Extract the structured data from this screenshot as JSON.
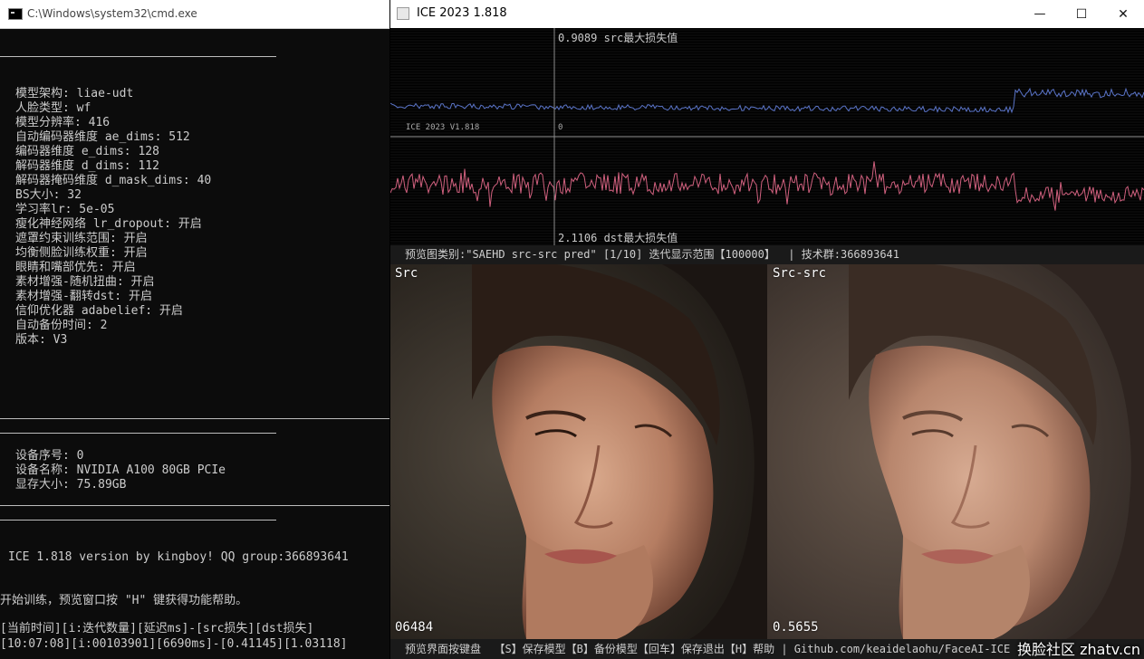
{
  "cmd": {
    "title": "C:\\Windows\\system32\\cmd.exe",
    "params": [
      "模型架构: liae-udt",
      "人脸类型: wf",
      "模型分辨率: 416",
      "自动编码器维度 ae_dims: 512",
      "编码器维度 e_dims: 128",
      "解码器维度 d_dims: 112",
      "解码器掩码维度 d_mask_dims: 40",
      "BS大小: 32",
      "学习率lr: 5e-05",
      "瘦化神经网络 lr_dropout: 开启",
      "遮罩约束训练范围: 开启",
      "均衡侧脸训练权重: 开启",
      "眼睛和嘴部优先: 开启",
      "素材增强-随机扭曲: 开启",
      "素材增强-翻转dst: 开启",
      "信仰优化器 adabelief: 开启",
      "自动备份时间: 2",
      "版本: V3"
    ],
    "device": [
      "设备序号: 0",
      "设备名称: NVIDIA A100 80GB PCIe",
      "显存大小: 75.89GB"
    ],
    "version_line": "ICE 1.818 version by kingboy! QQ group:366893641",
    "start_line": "开始训练，预览窗口按 \"H\" 键获得功能帮助。",
    "header_line": "[当前时间][i:迭代数量][延迟ms]-[src损失][dst损失]",
    "status_line": "[10:07:08][i:00103901][6690ms]-[0.41145][1.03118]"
  },
  "ice": {
    "title": "ICE 2023  1.818",
    "controls": {
      "minimize": "—",
      "maximize": "☐",
      "close": "✕"
    },
    "graph": {
      "src_label": "0.9089 src最大损失值",
      "dst_label": "2.1106 dst最大损失值",
      "version_label": "ICE 2023 V1.818",
      "zero_label": "0",
      "src_color": "#5a74c8",
      "dst_color": "#d0607e"
    },
    "info_bar": "预览图类别:\"SAEHD src-src pred\" [1/10] 迭代显示范围【100000】  | 技术群:366893641",
    "previews": [
      {
        "label": "Src",
        "value": "06484"
      },
      {
        "label": "Src-src",
        "value": "0.5655"
      }
    ],
    "help_bar": "预览界面按键盘  【S】保存模型【B】备份模型【回车】保存退出【H】帮助 | Github.com/keaidelaohu/FaceAI-ICE",
    "watermark": "换脸社区 zhatv.cn"
  }
}
